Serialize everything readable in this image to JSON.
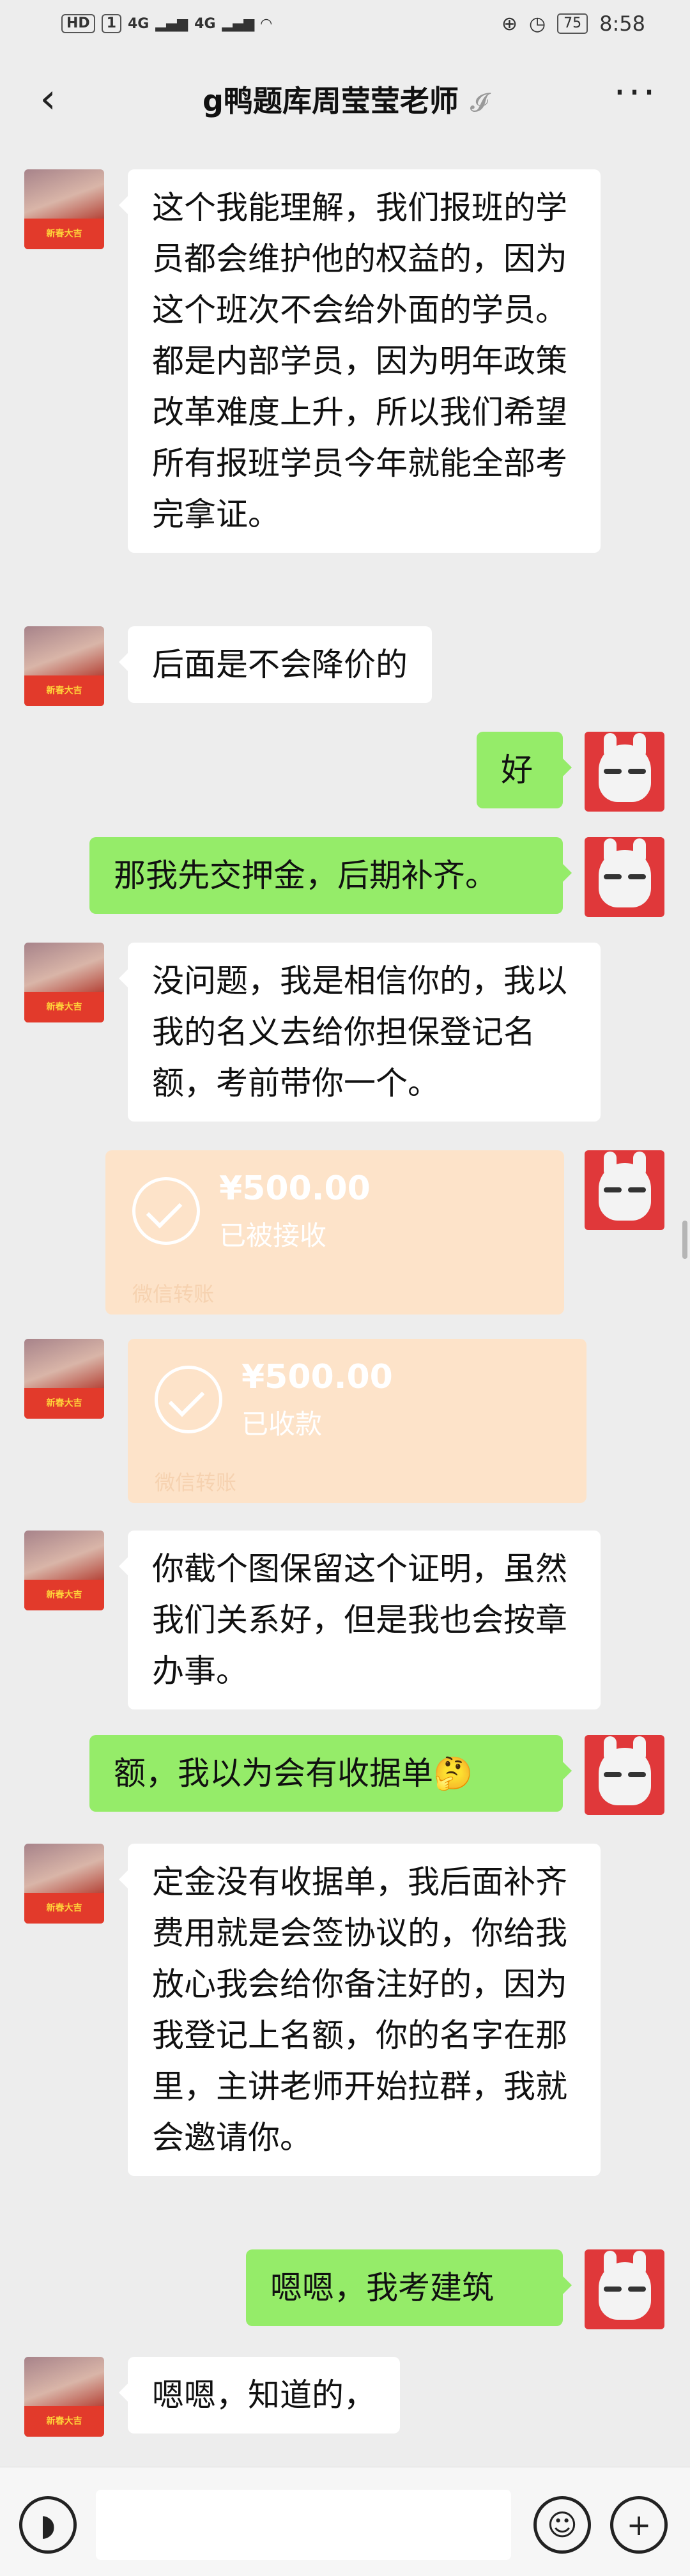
{
  "status_bar": {
    "left": {
      "hd": "HD",
      "sim": "1",
      "net1": "4G",
      "net2": "4G"
    },
    "battery": "75",
    "time": "8:58"
  },
  "header": {
    "back_icon": "chevron-left-icon",
    "title": "g鸭题库周莹莹老师",
    "ear_icon": "ear-icon",
    "more_icon": "more-icon"
  },
  "messages": [
    {
      "side": "left",
      "text": "这个我能理解，我们报班的学员都会维护他的权益的，因为这个班次不会给外面的学员。都是内部学员，因为明年政策改革难度上升，所以我们希望所有报班学员今年就能全部考完拿证。"
    },
    {
      "side": "left",
      "text": "后面是不会降价的"
    },
    {
      "side": "right",
      "text": "好"
    },
    {
      "side": "right",
      "text": "那我先交押金，后期补齐。"
    },
    {
      "side": "left",
      "text": "没问题，我是相信你的，我以我的名义去给你担保登记名额，考前带你一个。"
    },
    {
      "side": "right",
      "type": "transfer",
      "amount": "¥500.00",
      "status": "已被接收",
      "footer": "微信转账"
    },
    {
      "side": "left",
      "type": "transfer",
      "amount": "¥500.00",
      "status": "已收款",
      "footer": "微信转账"
    },
    {
      "side": "left",
      "text": "你截个图保留这个证明，虽然我们关系好，但是我也会按章办事。"
    },
    {
      "side": "right",
      "text": "额，我以为会有收据单🤔"
    },
    {
      "side": "left",
      "text": "定金没有收据单，我后面补齐费用就是会签协议的，你给我放心我会给你备注好的，因为我登记上名额，你的名字在那里，主讲老师开始拉群，我就会邀请你。"
    },
    {
      "side": "right",
      "text": "嗯嗯，我考建筑"
    },
    {
      "side": "left",
      "text": "嗯嗯，知道的，"
    }
  ],
  "avatar_badge": "新春大吉",
  "bottom_bar": {
    "voice_icon": "voice-icon",
    "emoji_icon": "emoji-icon",
    "plus_icon": "plus-icon"
  }
}
